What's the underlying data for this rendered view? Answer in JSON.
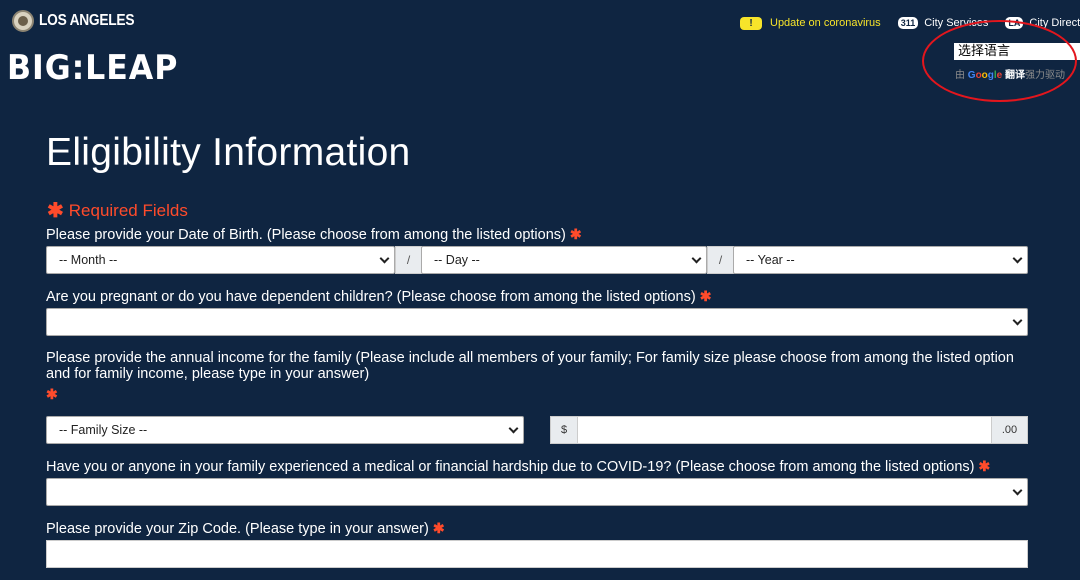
{
  "header": {
    "city_name": "LOS ANGELES",
    "logo_text": "BIG:LEAP",
    "alert_badge": "!",
    "alert_link": "Update on coronavirus",
    "services_badge": "311",
    "services_link": "City Services",
    "directory_badge": "LA",
    "directory_link": "City Directory"
  },
  "translate": {
    "select_value": "选择语言",
    "credit_prefix": "由",
    "credit_brand_google": "Google",
    "credit_brand_translate": "翻译",
    "credit_suffix": "强力驱动"
  },
  "form": {
    "title": "Eligibility Information",
    "required_note": "Required Fields",
    "asterisk": "✱",
    "dob_question": "Please provide your Date of Birth. (Please choose from among the listed options)",
    "month_placeholder": "-- Month --",
    "day_placeholder": "-- Day --",
    "year_placeholder": "-- Year --",
    "date_separator": "/",
    "pregnant_question": "Are you pregnant or do you have dependent children? (Please choose from among the listed options)",
    "pregnant_value": "",
    "income_question": "Please provide the annual income for the family (Please include all members of your family; For family size please choose from among the listed option and for family income, please type in your answer)",
    "family_size_placeholder": "-- Family Size --",
    "currency_prefix": "$",
    "currency_suffix": ".00",
    "income_value": "",
    "hardship_question": "Have you or anyone in your family experienced a medical or financial hardship due to COVID-19? (Please choose from among the listed options)",
    "hardship_value": "",
    "zip_question": "Please provide your Zip Code. (Please type in your answer)",
    "zip_value": ""
  },
  "colors": {
    "background": "#0f2541",
    "required": "#ff4b2b",
    "alert": "#f7e42a",
    "annotation_circle": "#e3161d"
  }
}
